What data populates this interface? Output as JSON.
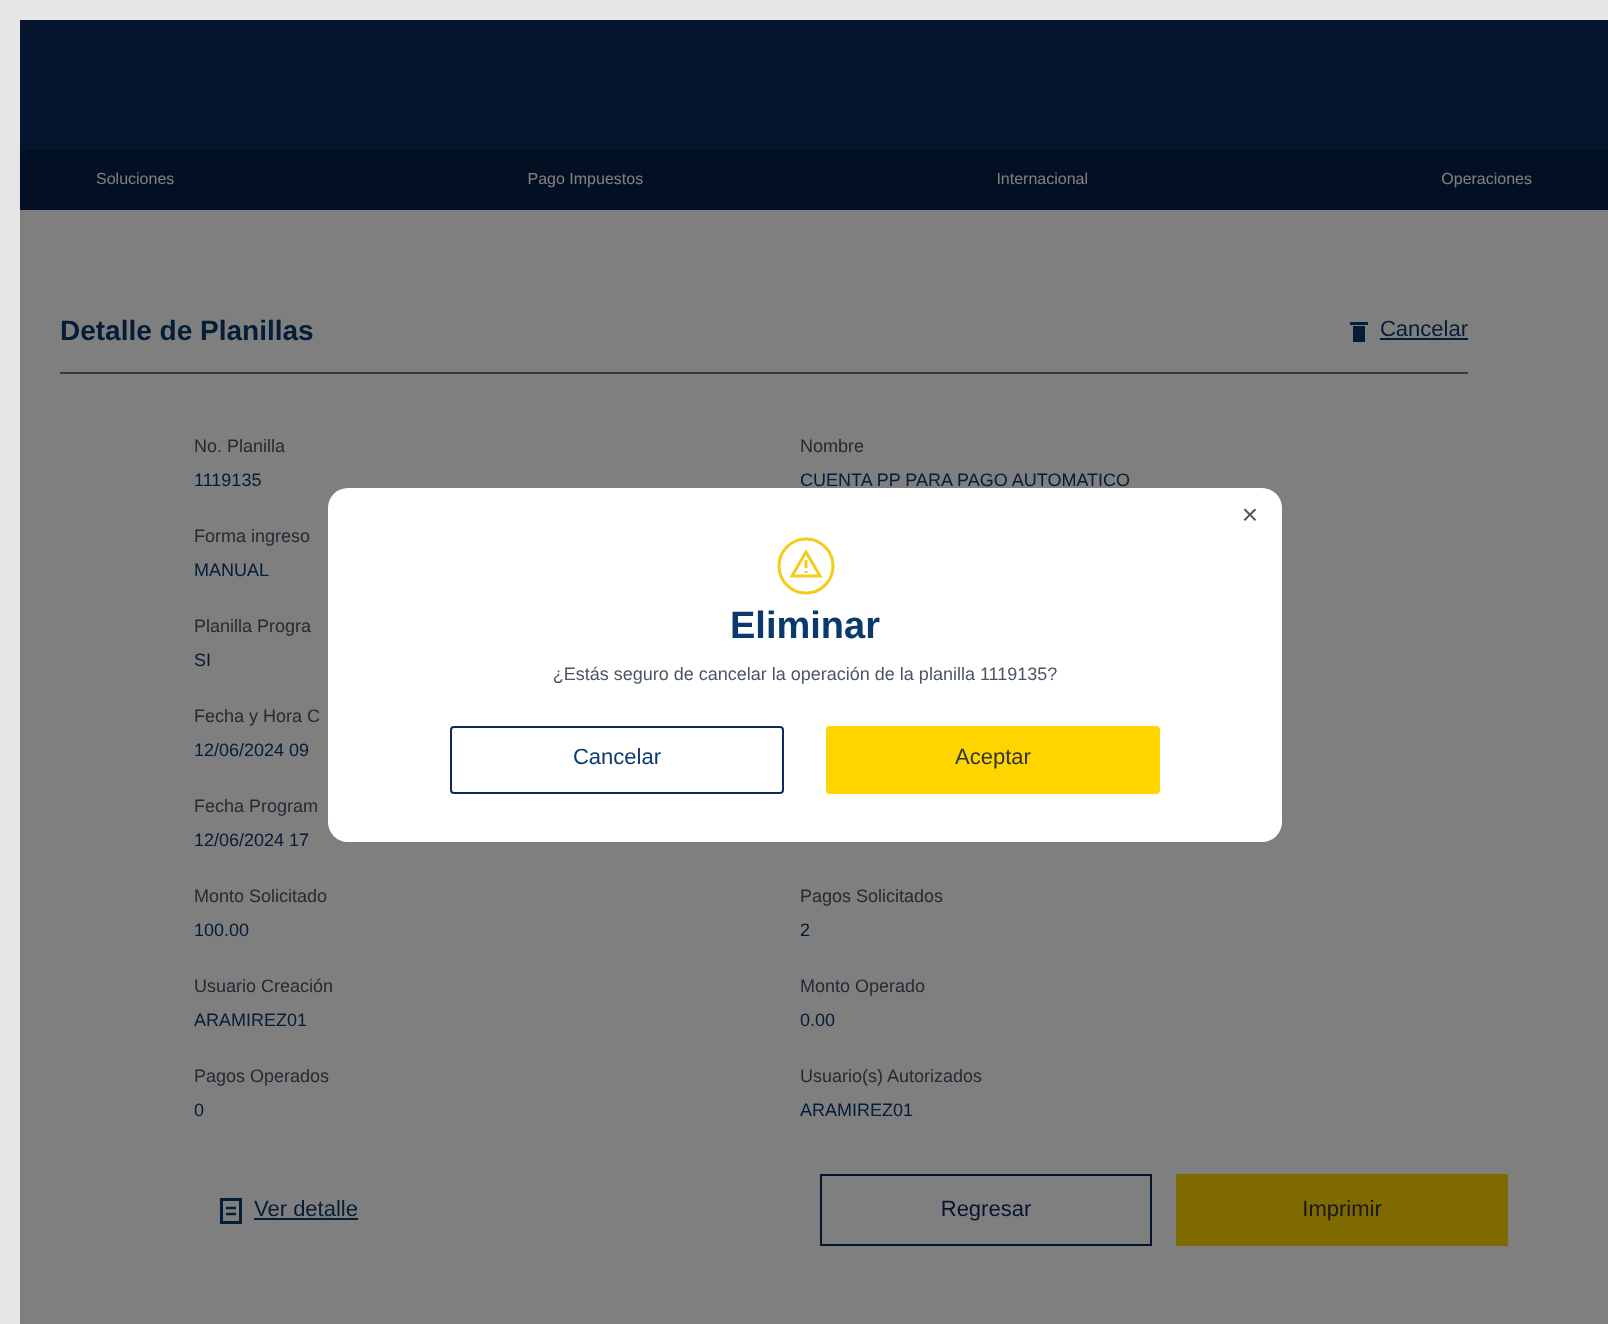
{
  "nav": [
    {
      "label": "Soluciones"
    },
    {
      "label": "Pago Impuestos"
    },
    {
      "label": "Internacional"
    },
    {
      "label": "Operaciones"
    }
  ],
  "page": {
    "title": "Detalle de Planillas",
    "cancel_link": "Cancelar"
  },
  "fields_left": [
    {
      "label": "No. Planilla",
      "value": "1119135"
    },
    {
      "label": "Forma ingreso",
      "value": "MANUAL"
    },
    {
      "label": "Planilla Progra",
      "value": "SI"
    },
    {
      "label": "Fecha y Hora C",
      "value": "12/06/2024 09"
    },
    {
      "label": "Fecha Program",
      "value": "12/06/2024 17"
    },
    {
      "label": "Monto Solicitado",
      "value": "100.00"
    },
    {
      "label": "Usuario Creación",
      "value": "ARAMIREZ01"
    },
    {
      "label": "Pagos Operados",
      "value": "0"
    }
  ],
  "fields_right": [
    {
      "label": "Nombre",
      "value": "CUENTA PP PARA PAGO AUTOMATICO"
    },
    {
      "label": "Pagos Solicitados",
      "value": "2"
    },
    {
      "label": "Monto Operado",
      "value": "0.00"
    },
    {
      "label": "Usuario(s) Autorizados",
      "value": "ARAMIREZ01"
    }
  ],
  "footer": {
    "detail_link": "Ver detalle",
    "back_button": "Regresar",
    "print_button": "Imprimir"
  },
  "dialog": {
    "close": "×",
    "title": "Eliminar",
    "message": "¿Estás seguro de cancelar la operación de la planilla 1119135?",
    "cancel_button": "Cancelar",
    "accept_button": "Aceptar"
  }
}
